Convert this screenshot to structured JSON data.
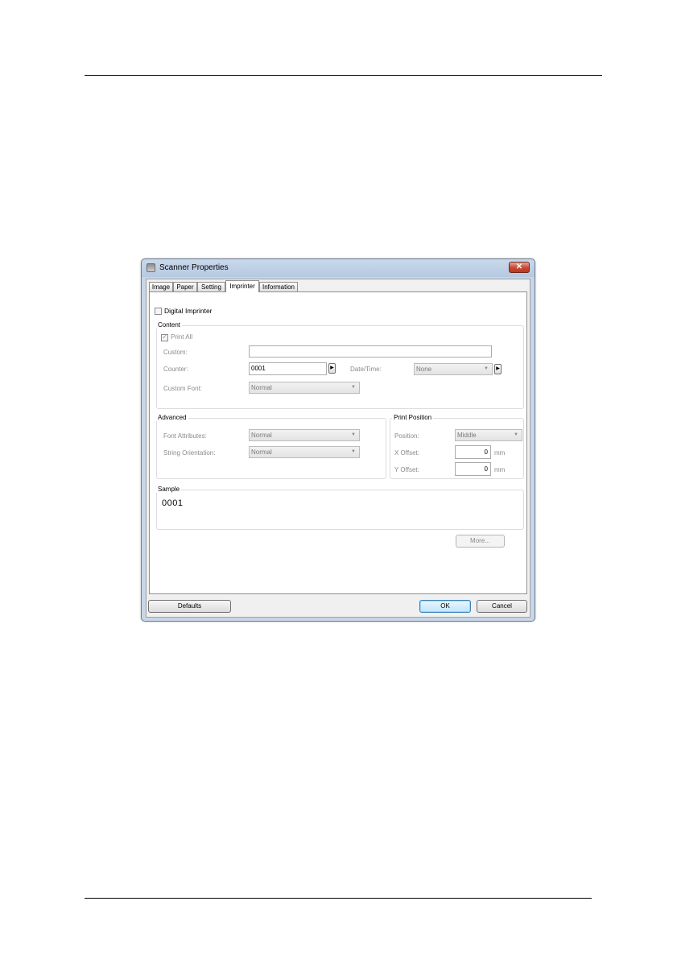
{
  "window": {
    "title": "Scanner Properties",
    "close_label": "✕"
  },
  "tabs": [
    {
      "label": "Image"
    },
    {
      "label": "Paper"
    },
    {
      "label": "Setting"
    },
    {
      "label": "Imprinter",
      "active": true
    },
    {
      "label": "Information"
    }
  ],
  "digital_imprinter": {
    "label": "Digital Imprinter",
    "checked": false
  },
  "content": {
    "title": "Content",
    "print_all": {
      "label": "Print All",
      "checked": true
    },
    "custom": {
      "label": "Custom:",
      "value": ""
    },
    "counter": {
      "label": "Counter:",
      "value": "0001"
    },
    "datetime": {
      "label": "Date/Time:",
      "value": "None"
    },
    "custom_font": {
      "label": "Custom Font:",
      "value": "Normal"
    }
  },
  "advanced": {
    "title": "Advanced",
    "font_attributes": {
      "label": "Font Attributes:",
      "value": "Normal"
    },
    "string_orientation": {
      "label": "String Orientation:",
      "value": "Normal"
    }
  },
  "print_position": {
    "title": "Print Position",
    "position": {
      "label": "Position:",
      "value": "Middle"
    },
    "x_offset": {
      "label": "X Offset:",
      "value": "0",
      "unit": "mm"
    },
    "y_offset": {
      "label": "Y Offset:",
      "value": "0",
      "unit": "mm"
    }
  },
  "sample": {
    "title": "Sample",
    "text": "0001"
  },
  "buttons": {
    "more": "More...",
    "defaults": "Defaults",
    "ok": "OK",
    "cancel": "Cancel"
  },
  "icons": {
    "spin_right": "▶",
    "dropdown": "▼",
    "check": "✓"
  }
}
